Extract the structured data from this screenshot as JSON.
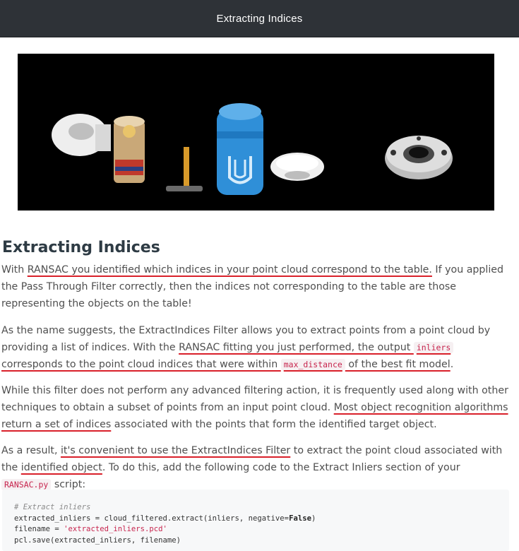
{
  "header": {
    "title": "Extracting Indices"
  },
  "figure": {
    "alt": "point cloud objects"
  },
  "article": {
    "heading": "Extracting Indices",
    "p1": {
      "a": "With ",
      "u1": "RANSAC you identified which indices in your point cloud correspond to the table.",
      "b": " If you applied the Pass Through Filter correctly, then the indices not corresponding to the table are those representing the objects on the table!"
    },
    "p2": {
      "a": "As the name suggests, the ExtractIndices Filter allows you to extract points from a point cloud by providing a list of indices. With the ",
      "u1": "RANSAC fitting you just performed, the output ",
      "code1": "inliers",
      "u2": " corresponds to the point cloud indices that were within ",
      "code2": "max_distance",
      "u3": " of the best fit model",
      "b": "."
    },
    "p3": {
      "a": "While this filter does not perform any advanced filtering action, it is frequently used along with other techniques to obtain a subset of points from an input point cloud. ",
      "u1": "Most object recognition algorithms return a set of indices",
      "b": " associated with the points that form the identified target object."
    },
    "p4": {
      "a": "As a result, ",
      "u1": "it's convenient to use the ExtractIndices Filter",
      "b": " to extract the point cloud associated with the ",
      "u2": "identified object",
      "c": ". To do this, add the following code to the Extract Inliers section of your ",
      "code1": "RANSAC.py",
      "d": " script:"
    }
  },
  "code": {
    "comment": "# Extract inliers",
    "line2a": "extracted_inliers = cloud_filtered.extract(inliers, negative=",
    "line2kw": "False",
    "line2b": ")",
    "line3a": "filename = ",
    "line3str": "'extracted_inliers.pcd'",
    "line4": "pcl.save(extracted_inliers, filename)"
  },
  "colors": {
    "underline": "#d9202a",
    "header_bg": "#2e3237",
    "inline_code": "#c7254e"
  }
}
